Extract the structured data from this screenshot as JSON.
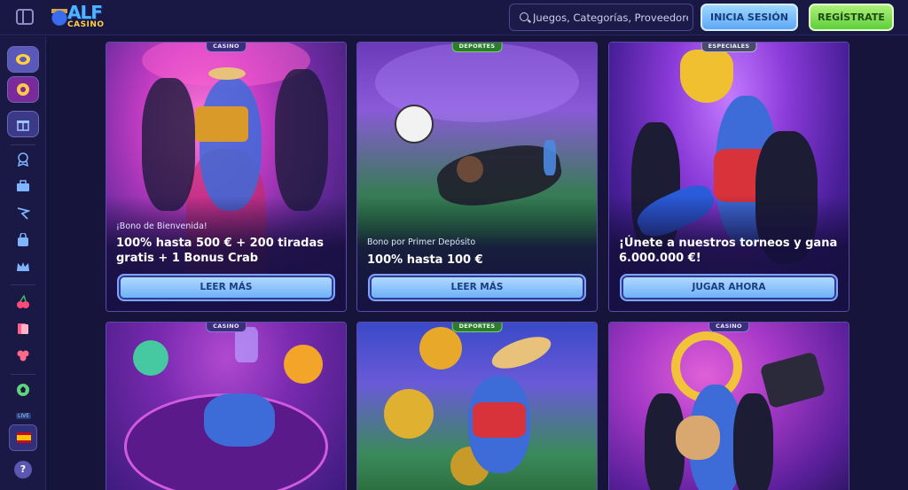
{
  "header": {
    "logo": {
      "name": "ALF",
      "sub": "CASINO"
    },
    "search": {
      "placeholder": "Juegos, Categorías, Proveedores"
    },
    "login_label": "INICIA SESIÓN",
    "register_label": "REGÍSTRATE"
  },
  "sidebar": {
    "items": [
      {
        "icon": "casino-chip-icon"
      },
      {
        "icon": "sports-icon"
      },
      {
        "icon": "gift-icon"
      },
      {
        "icon": "medal-icon"
      },
      {
        "icon": "briefcase-icon"
      },
      {
        "icon": "flag-icon"
      },
      {
        "icon": "bag-icon"
      },
      {
        "icon": "crown-icon"
      },
      {
        "icon": "cherries-icon"
      },
      {
        "icon": "cards-icon"
      },
      {
        "icon": "clover-icon"
      },
      {
        "icon": "soccer-ball-icon"
      }
    ],
    "live_badge": "LIVE",
    "language": "es",
    "help_label": "?"
  },
  "cards": [
    {
      "tag": "CASINO",
      "small": "¡Bono de Bienvenida!",
      "title": "100% hasta 500 € + 200 tiradas gratis + 1 Bonus Crab",
      "button": "LEER MÁS"
    },
    {
      "tag": "DEPORTES",
      "small": "Bono por Primer Depósito",
      "title": "100% hasta 100 €",
      "button": "LEER MÁS"
    },
    {
      "tag": "ESPECIALES",
      "small": "",
      "title": "¡Únete a nuestros torneos y gana 6.000.000 €!",
      "button": "JUGAR AHORA"
    },
    {
      "tag": "CASINO"
    },
    {
      "tag": "DEPORTES"
    },
    {
      "tag": "CASINO"
    }
  ],
  "colors": {
    "background": "#16143a",
    "accent_blue": "#68aef7",
    "accent_green": "#5fcf3b",
    "card_border": "#5b4aa8"
  }
}
